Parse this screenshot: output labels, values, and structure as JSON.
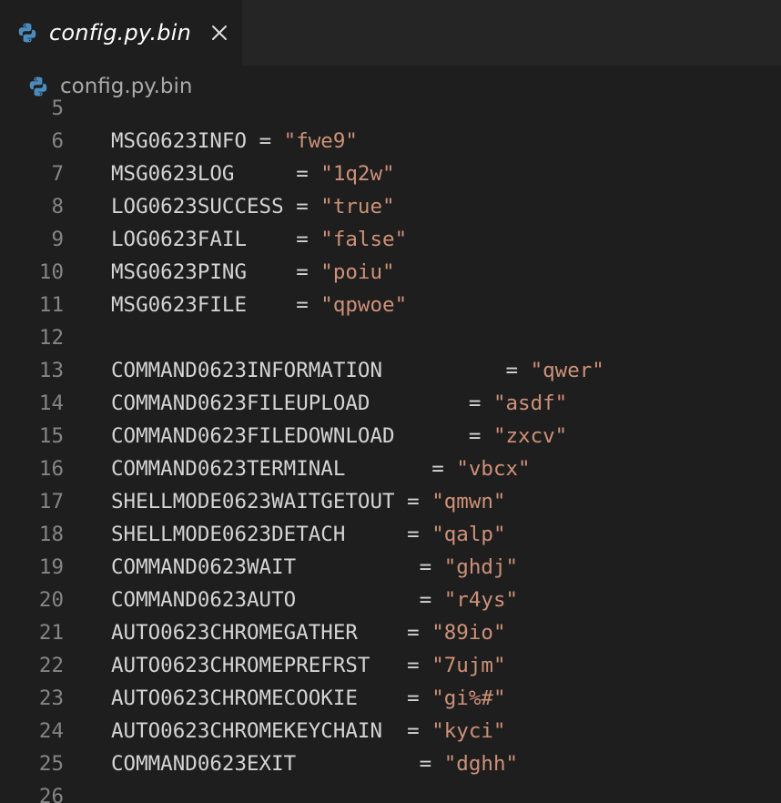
{
  "tab": {
    "filename": "config.py.bin",
    "icon": "python-icon",
    "close_icon": "close-icon"
  },
  "breadcrumb": {
    "filename": "config.py.bin",
    "icon": "python-icon"
  },
  "colors": {
    "background": "#1e1e1e",
    "tabbar": "#252526",
    "line_number": "#858585",
    "identifier": "#d4d4d4",
    "string": "#ce9178",
    "python_blue": "#4b8bbe",
    "python_yellow": "#ffd43b"
  },
  "lines": [
    {
      "num": "5",
      "name": "",
      "pad": "",
      "value": ""
    },
    {
      "num": "6",
      "name": "MSG0623INFO",
      "pad": " ",
      "value": "\"fwe9\""
    },
    {
      "num": "7",
      "name": "MSG0623LOG",
      "pad": "     ",
      "value": "\"1q2w\""
    },
    {
      "num": "8",
      "name": "LOG0623SUCCESS",
      "pad": " ",
      "value": "\"true\""
    },
    {
      "num": "9",
      "name": "LOG0623FAIL",
      "pad": "    ",
      "value": "\"false\""
    },
    {
      "num": "10",
      "name": "MSG0623PING",
      "pad": "    ",
      "value": "\"poiu\""
    },
    {
      "num": "11",
      "name": "MSG0623FILE",
      "pad": "    ",
      "value": "\"qpwoe\""
    },
    {
      "num": "12",
      "name": "",
      "pad": "",
      "value": ""
    },
    {
      "num": "13",
      "name": "COMMAND0623INFORMATION",
      "pad": "          ",
      "value": "\"qwer\""
    },
    {
      "num": "14",
      "name": "COMMAND0623FILEUPLOAD",
      "pad": "        ",
      "value": "\"asdf\""
    },
    {
      "num": "15",
      "name": "COMMAND0623FILEDOWNLOAD",
      "pad": "      ",
      "value": "\"zxcv\""
    },
    {
      "num": "16",
      "name": "COMMAND0623TERMINAL",
      "pad": "       ",
      "value": "\"vbcx\""
    },
    {
      "num": "17",
      "name": "SHELLMODE0623WAITGETOUT",
      "pad": " ",
      "value": "\"qmwn\""
    },
    {
      "num": "18",
      "name": "SHELLMODE0623DETACH",
      "pad": "     ",
      "value": "\"qalp\""
    },
    {
      "num": "19",
      "name": "COMMAND0623WAIT",
      "pad": "          ",
      "value": "\"ghdj\""
    },
    {
      "num": "20",
      "name": "COMMAND0623AUTO",
      "pad": "          ",
      "value": "\"r4ys\""
    },
    {
      "num": "21",
      "name": "AUTO0623CHROMEGATHER",
      "pad": "    ",
      "value": "\"89io\""
    },
    {
      "num": "22",
      "name": "AUTO0623CHROMEPREFRST",
      "pad": "   ",
      "value": "\"7ujm\""
    },
    {
      "num": "23",
      "name": "AUTO0623CHROMECOOKIE",
      "pad": "    ",
      "value": "\"gi%#\""
    },
    {
      "num": "24",
      "name": "AUTO0623CHROMEKEYCHAIN",
      "pad": "  ",
      "value": "\"kyci\""
    },
    {
      "num": "25",
      "name": "COMMAND0623EXIT",
      "pad": "          ",
      "value": "\"dghh\""
    },
    {
      "num": "26",
      "name": "",
      "pad": "",
      "value": ""
    }
  ]
}
